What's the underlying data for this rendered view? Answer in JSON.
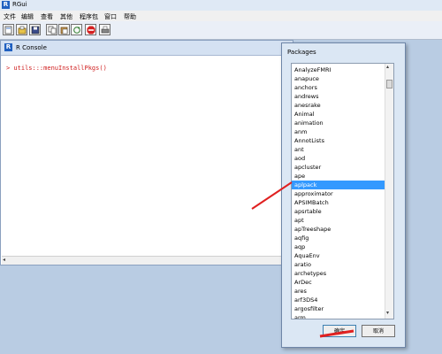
{
  "window": {
    "title": "RGui"
  },
  "menu": {
    "items": [
      "文件",
      "编辑",
      "查看",
      "其他",
      "程序包",
      "窗口",
      "帮助"
    ]
  },
  "toolbar": {
    "buttons": [
      "open-script",
      "load-workspace",
      "save-workspace",
      "copy",
      "paste",
      "copy-paste",
      "stop",
      "print"
    ]
  },
  "console": {
    "title": "R Console",
    "command": "> utils:::menuInstallPkgs()"
  },
  "dialog": {
    "title": "Packages",
    "packages": [
      "AnalyzeFMRI",
      "anapuce",
      "anchors",
      "andrews",
      "anesrake",
      "Animal",
      "animation",
      "anm",
      "AnnotLists",
      "ant",
      "aod",
      "apcluster",
      "ape",
      "aplpack",
      "approximator",
      "APSIMBatch",
      "apsrtable",
      "apt",
      "apTreeshape",
      "aqfig",
      "aqp",
      "AquaEnv",
      "aratio",
      "archetypes",
      "ArDec",
      "ares",
      "arf3DS4",
      "argosfilter",
      "arm"
    ],
    "selected": "aplpack",
    "ok_label": "确定",
    "cancel_label": "取消"
  },
  "colors": {
    "selection": "#3399ff",
    "command_text": "#d02020",
    "annotation_red": "#e02020"
  }
}
